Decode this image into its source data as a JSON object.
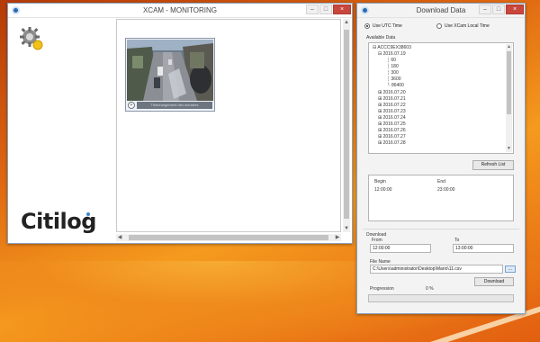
{
  "monitoring_window": {
    "title": "XCAM - MONITORING",
    "brand": "Citilog",
    "camera_caption": "Téléchargement des données",
    "camera_toggle": "+"
  },
  "download_window": {
    "title": "Download Data",
    "time_mode": {
      "options": [
        "Use UTC Time",
        "Use XCam Local Time"
      ],
      "selected": "Use UTC Time"
    },
    "available_data_label": "Available Data",
    "tree": {
      "root": "ACCC9EX38603",
      "expanded_date": "2016.07.19",
      "expanded_children": [
        "60",
        "180",
        "300",
        "3600",
        "86400"
      ],
      "dates": [
        "2016.07.20",
        "2016.07.21",
        "2016.07.22",
        "2016.07.23",
        "2016.07.24",
        "2016.07.25",
        "2016.07.26",
        "2016.07.27",
        "2016.07.28"
      ]
    },
    "refresh_button": "Refresh List",
    "ranges": {
      "headers": [
        "Begin",
        "End"
      ],
      "rows": [
        [
          "12:00:00",
          "23:00:00"
        ]
      ]
    },
    "download_section_label": "Download",
    "from_label": "From",
    "from_value": "12:00:00",
    "to_label": "To",
    "to_value": "13:00:00",
    "file_name_label": "File Name",
    "file_name_value": "C:\\Users\\administrator\\Desktop\\Mario\\11.csv",
    "browse_button": "...",
    "download_button": "Download",
    "progression_label": "Progression",
    "progression_value": "0 %",
    "progress_fraction": 0
  },
  "window_controls": {
    "minimize": "–",
    "maximize": "□",
    "close": "×"
  },
  "colors": {
    "progress_fill": "#06b025",
    "close_button": "#c9463d",
    "desktop": "#e06a12"
  },
  "icons": [
    "app-icon",
    "gear-icon",
    "minimize-icon",
    "maximize-icon",
    "close-icon",
    "expand-icon",
    "collapse-icon"
  ]
}
